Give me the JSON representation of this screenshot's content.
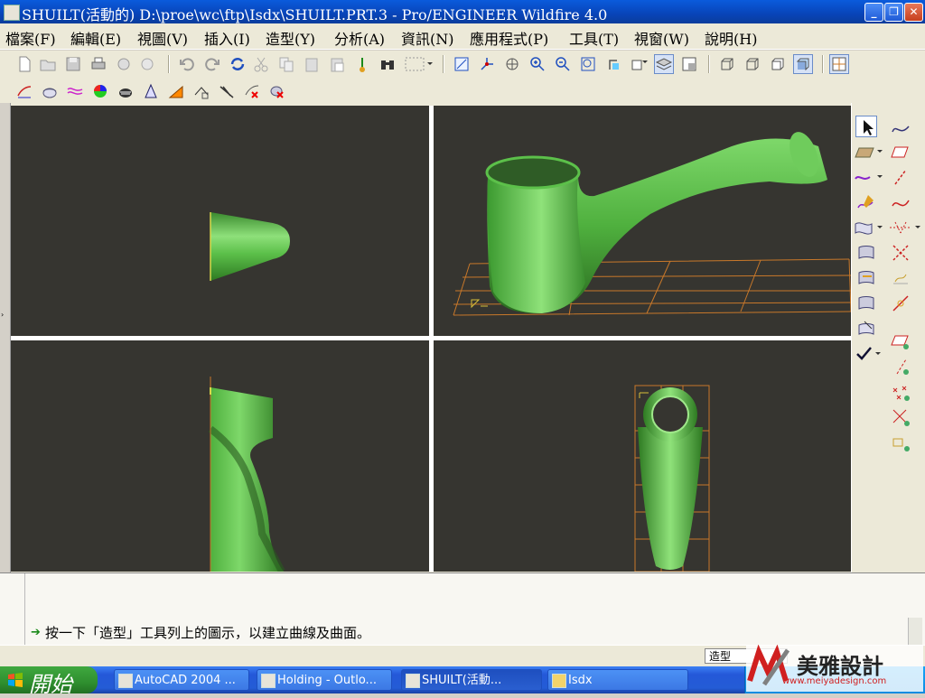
{
  "window": {
    "title": "SHUILT(活動的) D:\\proe\\wc\\ftp\\Isdx\\SHUILT.PRT.3 - Pro/ENGINEER Wildfire 4.0",
    "minimize": "_",
    "maximize": "❐",
    "close": "✕"
  },
  "menu": {
    "items": [
      "檔案(F)",
      "編輯(E)",
      "視圖(V)",
      "插入(I)",
      "造型(Y)",
      "分析(A)",
      "資訊(N)",
      "應用程式(P)",
      "工具(T)",
      "視窗(W)",
      "說明(H)"
    ]
  },
  "message": {
    "text": "按一下「造型」工具列上的圖示，以建立曲線及曲面。"
  },
  "status": {
    "mode": "造型"
  },
  "taskbar": {
    "start_label": "開始",
    "tasks": [
      "AutoCAD 2004 ...",
      "Holding - Outlo...",
      "SHUILT(活動...",
      "Isdx"
    ],
    "active_task": 2
  },
  "watermark": {
    "cn": "美雅設計",
    "url": "www.meiyadesign.com",
    "logo": "M"
  },
  "colors": {
    "model_green": "#5cc04a",
    "viewport_bg": "#363530",
    "grid_orange": "#c8782a",
    "xp_title": "#0a5bdc"
  }
}
